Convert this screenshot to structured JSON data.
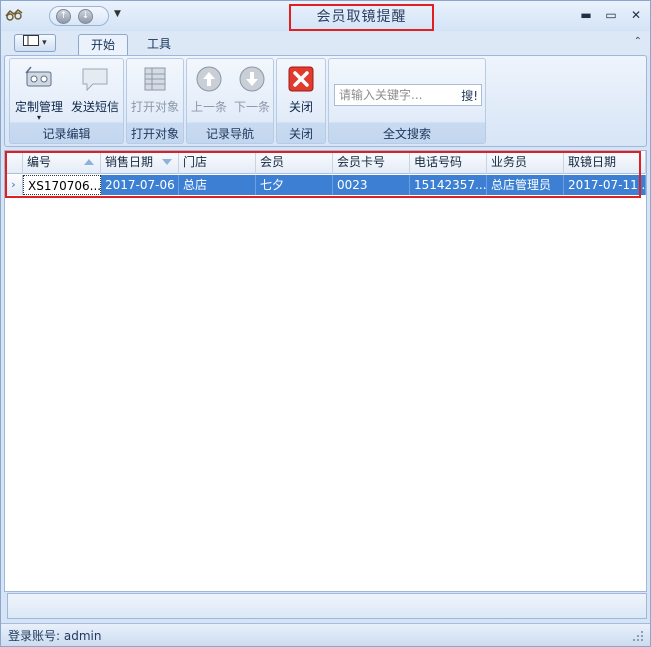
{
  "window": {
    "title": "会员取镜提醒",
    "minimize": "▬",
    "maximize": "▭",
    "close": "✕"
  },
  "ribbon": {
    "tabs": [
      {
        "label": "开始",
        "active": true
      },
      {
        "label": "工具",
        "active": false
      }
    ],
    "groups": {
      "record_edit": {
        "label": "记录编辑",
        "buttons": {
          "custom_manage": "定制管理",
          "send_sms": "发送短信"
        }
      },
      "open_object": {
        "label": "打开对象",
        "buttons": {
          "open": "打开对象"
        }
      },
      "record_nav": {
        "label": "记录导航",
        "buttons": {
          "prev": "上一条",
          "next": "下一条"
        }
      },
      "close": {
        "label": "关闭",
        "buttons": {
          "close": "关闭"
        }
      },
      "fulltext_search": {
        "label": "全文搜索",
        "placeholder": "请输入关键字...",
        "search_button": "搜!"
      }
    }
  },
  "grid": {
    "columns": [
      "编号",
      "销售日期",
      "门店",
      "会员",
      "会员卡号",
      "电话号码",
      "业务员",
      "取镜日期"
    ],
    "rows": [
      [
        "XS170706...",
        "2017-07-06",
        "总店",
        "七夕",
        "0023",
        "15142357...",
        "总店管理员",
        "2017-07-11..."
      ]
    ]
  },
  "status": {
    "login": "登录账号: admin"
  },
  "colors": {
    "selection": "#3d80d3",
    "accent_border": "#e02020",
    "ribbon_bg": "#d7e5f6"
  }
}
